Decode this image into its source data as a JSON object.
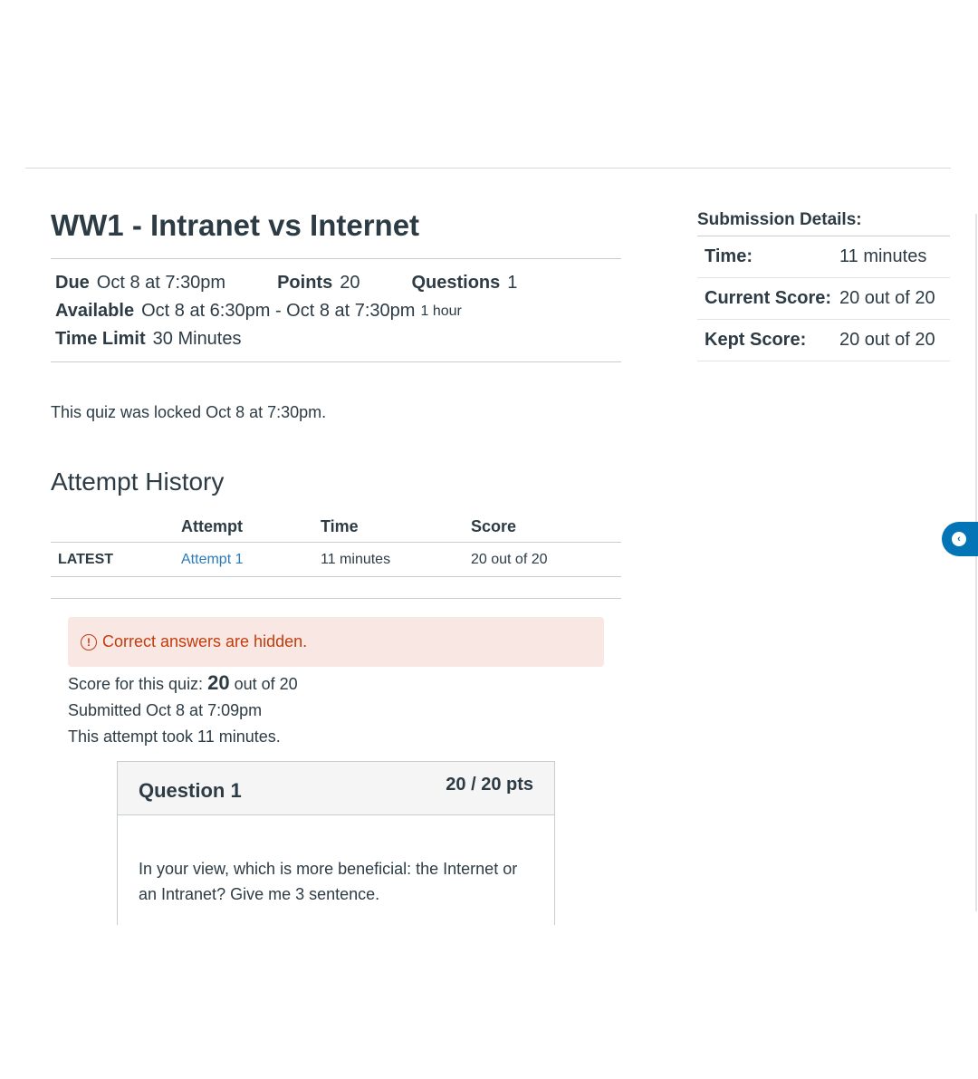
{
  "quiz": {
    "title": "WW1 - Intranet vs Internet",
    "due_label": "Due",
    "due_value": "Oct 8 at 7:30pm",
    "points_label": "Points",
    "points_value": "20",
    "questions_label": "Questions",
    "questions_value": "1",
    "available_label": "Available",
    "available_value": "Oct 8 at 6:30pm - Oct 8 at 7:30pm",
    "available_duration": "1 hour",
    "time_limit_label": "Time Limit",
    "time_limit_value": "30 Minutes",
    "locked_message": "This quiz was locked Oct 8 at 7:30pm."
  },
  "attempt_history": {
    "heading": "Attempt History",
    "columns": [
      "",
      "Attempt",
      "Time",
      "Score"
    ],
    "rows": [
      {
        "tag": "LATEST",
        "attempt": "Attempt 1",
        "time": "11 minutes",
        "score": "20 out of 20"
      }
    ]
  },
  "alert": {
    "icon": "warning-circle-icon",
    "text": "Correct answers are hidden."
  },
  "result": {
    "score_prefix": "Score for this quiz:",
    "score_value": "20",
    "score_suffix": "out of 20",
    "submitted": "Submitted Oct 8 at 7:09pm",
    "duration": "This attempt took 11 minutes."
  },
  "question": {
    "title": "Question 1",
    "points": "20 / 20 pts",
    "text": "In your view, which is more beneficial: the Internet or an Intranet? Give me 3 sentence."
  },
  "submission_details": {
    "heading": "Submission Details:",
    "rows": [
      {
        "label": "Time:",
        "value": "11 minutes"
      },
      {
        "label": "Current Score:",
        "value": "20 out of 20"
      },
      {
        "label": "Kept Score:",
        "value": "20 out of 20"
      }
    ]
  },
  "floating_button": {
    "icon": "chat-bubble-icon"
  },
  "colors": {
    "link": "#2b7abc",
    "alert_text": "#c23c0d",
    "alert_bg": "#f9e7e4",
    "fab": "#0374b5"
  }
}
